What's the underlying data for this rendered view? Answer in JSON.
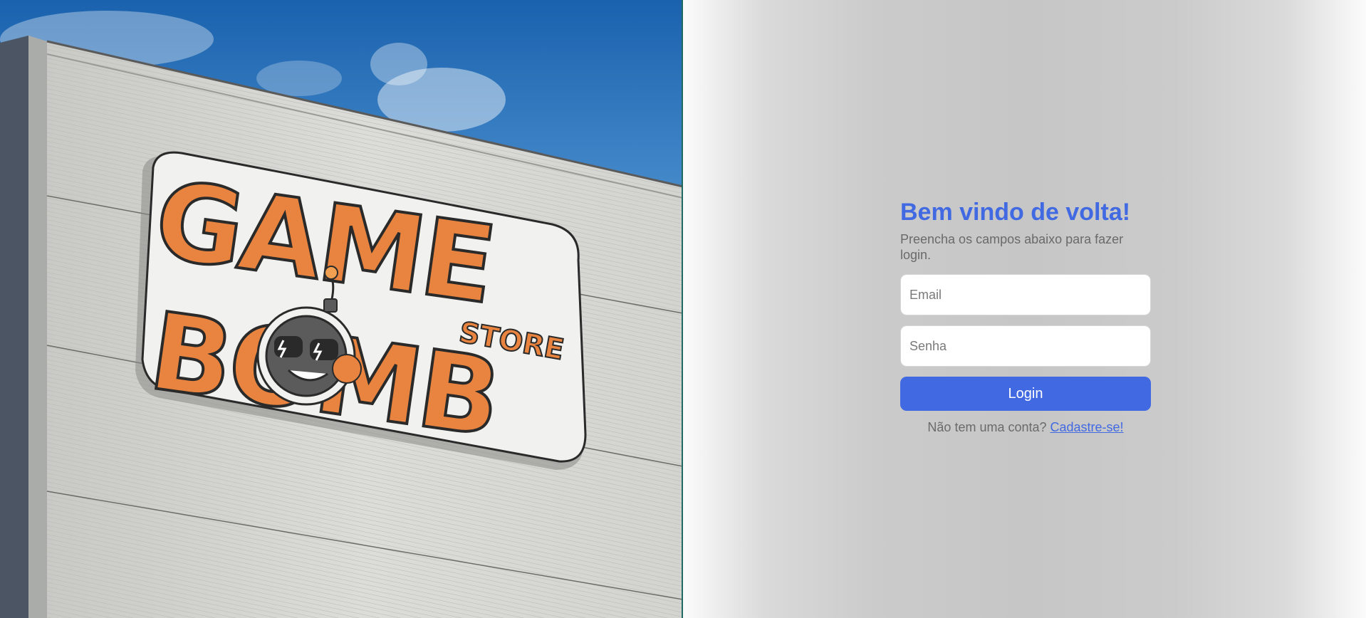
{
  "hero": {
    "sign_lines": [
      "GAME",
      "BOMB"
    ],
    "sign_badge": "STORE",
    "colors": {
      "sky_top": "#1a64b0",
      "sky_bottom": "#8fbde2",
      "wall": "#d9d9d5",
      "logo_orange": "#e8843f",
      "logo_outline": "#2a2a2a"
    },
    "icon": "game-bomb-store-logo"
  },
  "login": {
    "title": "Bem vindo de volta!",
    "subtitle": "Preencha os campos abaixo para fazer login.",
    "email_placeholder": "Email",
    "password_placeholder": "Senha",
    "submit_label": "Login",
    "signup_prompt": "Não tem uma conta? ",
    "signup_link": "Cadastre-se!",
    "colors": {
      "accent": "#4169e1",
      "muted_text": "#6a6a6a"
    }
  }
}
